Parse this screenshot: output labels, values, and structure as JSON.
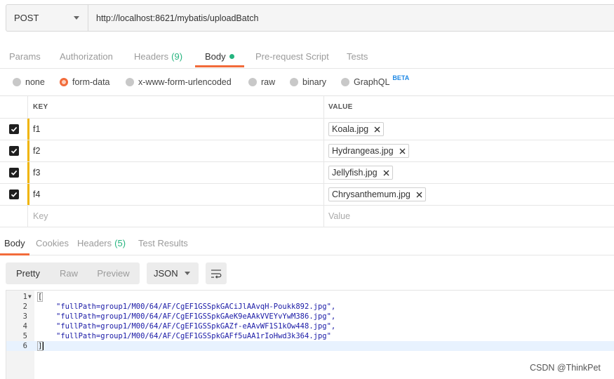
{
  "request": {
    "method": "POST",
    "url": "http://localhost:8621/mybatis/uploadBatch"
  },
  "tabs": [
    {
      "label": "Params"
    },
    {
      "label": "Authorization"
    },
    {
      "label": "Headers",
      "count": "(9)"
    },
    {
      "label": "Body"
    },
    {
      "label": "Pre-request Script"
    },
    {
      "label": "Tests"
    }
  ],
  "body_types": [
    {
      "label": "none"
    },
    {
      "label": "form-data"
    },
    {
      "label": "x-www-form-urlencoded"
    },
    {
      "label": "raw"
    },
    {
      "label": "binary"
    },
    {
      "label": "GraphQL",
      "badge": "BETA"
    }
  ],
  "form_table": {
    "key_header": "KEY",
    "value_header": "VALUE",
    "rows": [
      {
        "key": "f1",
        "file": "Koala.jpg"
      },
      {
        "key": "f2",
        "file": "Hydrangeas.jpg"
      },
      {
        "key": "f3",
        "file": "Jellyfish.jpg"
      },
      {
        "key": "f4",
        "file": "Chrysanthemum.jpg"
      }
    ],
    "key_placeholder": "Key",
    "value_placeholder": "Value"
  },
  "response_tabs": [
    {
      "label": "Body"
    },
    {
      "label": "Cookies"
    },
    {
      "label": "Headers",
      "count": "(5)"
    },
    {
      "label": "Test Results"
    }
  ],
  "response_toolbar": {
    "view_modes": [
      "Pretty",
      "Raw",
      "Preview"
    ],
    "format": "JSON"
  },
  "response_body": {
    "line_numbers": [
      "1",
      "2",
      "3",
      "4",
      "5",
      "6"
    ],
    "open": "[",
    "items": [
      "\"fullPath=group1/M00/64/AF/CgEF1GSSpkGACiJlAAvqH-Poukk892.jpg\",",
      "\"fullPath=group1/M00/64/AF/CgEF1GSSpkGAeK9eAAkVVEYvYwM386.jpg\",",
      "\"fullPath=group1/M00/64/AF/CgEF1GSSpkGAZf-eAAvWF1S1kOw448.jpg\",",
      "\"fullPath=group1/M00/64/AF/CgEF1GSSpkGAFf5uAA1rIoHwd3k364.jpg\""
    ],
    "close": "]"
  },
  "watermark": "CSDN @ThinkPet",
  "colors": {
    "accent": "#f26b3a",
    "count_green": "#26b47f",
    "enabled_bar": "#f0b400",
    "beta_blue": "#1e88e5"
  }
}
